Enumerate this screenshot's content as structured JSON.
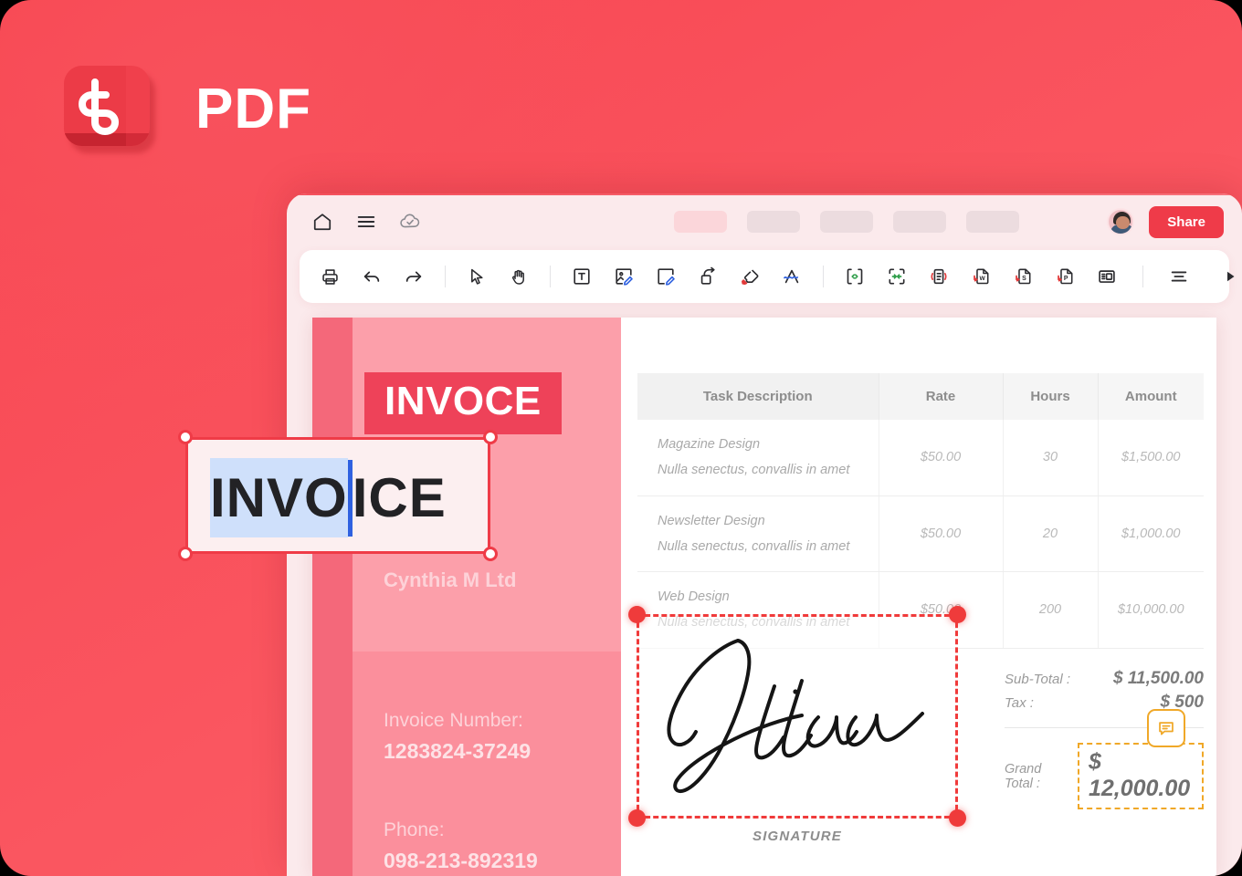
{
  "brand": {
    "title": "PDF",
    "logo_icon": "pdf-app-logo-icon"
  },
  "topbar": {
    "icons": [
      "home-icon",
      "menu-icon",
      "cloud-check-icon"
    ],
    "skeleton_tabs": [
      "tab-placeholder-1",
      "tab-placeholder-2",
      "tab-placeholder-3",
      "tab-placeholder-4",
      "tab-placeholder-5"
    ],
    "avatar": "user-avatar",
    "share_label": "Share",
    "share_color": "#ef3b49"
  },
  "toolbar": {
    "groups": [
      [
        "print-icon",
        "undo-icon",
        "redo-icon"
      ],
      [
        "select-cursor-icon",
        "hand-pan-icon"
      ],
      [
        "edit-text-box-icon",
        "edit-image-icon",
        "edit-page-icon",
        "add-link-icon",
        "eraser-icon",
        "signature-draw-icon"
      ],
      [
        "compress-pdf-icon",
        "split-pdf-icon",
        "rotate-page-icon",
        "export-word-icon",
        "export-excel-icon",
        "export-powerpoint-icon",
        "organize-pages-icon"
      ],
      [
        "list-align-icon",
        "more-tools-play-icon"
      ]
    ]
  },
  "document": {
    "left_panel": {
      "title_background_text": "INVOCE",
      "company_name": "Cynthia M Ltd",
      "fields": [
        {
          "label": "Invoice Number:",
          "value": "1283824-37249"
        },
        {
          "label": "Phone:",
          "value": "098-213-892319"
        }
      ]
    },
    "table": {
      "columns": [
        "Task Description",
        "Rate",
        "Hours",
        "Amount"
      ],
      "rows": [
        {
          "task": "Magazine Design",
          "subtitle": "Nulla senectus, convallis in amet",
          "rate": "$50.00",
          "hours": "30",
          "amount": "$1,500.00"
        },
        {
          "task": "Newsletter Design",
          "subtitle": "Nulla senectus, convallis in amet",
          "rate": "$50.00",
          "hours": "20",
          "amount": "$1,000.00"
        },
        {
          "task": "Web Design",
          "subtitle": "Nulla senectus, convallis in amet",
          "rate": "$50.00",
          "hours": "200",
          "amount": "$10,000.00"
        }
      ]
    },
    "totals": {
      "subtotal_label": "Sub-Total :",
      "subtotal_value": "$ 11,500.00",
      "tax_label": "Tax :",
      "tax_value": "$ 500",
      "grand_label": "Grand Total :",
      "grand_value": "$ 12,000.00",
      "grand_highlight_color": "#f0a828",
      "comment_icon": "comment-bubble-icon"
    },
    "signature": {
      "name": "Jillian",
      "caption": "SIGNATURE",
      "selection_color": "#ef3b3b"
    }
  },
  "text_edit_overlay": {
    "selected_text": "INVO",
    "remaining_text": "ICE",
    "full_text": "INVOICE",
    "selection_highlight_color": "#cfe0fb",
    "caret_color": "#2f61e0",
    "frame_color": "#ef3b47"
  }
}
